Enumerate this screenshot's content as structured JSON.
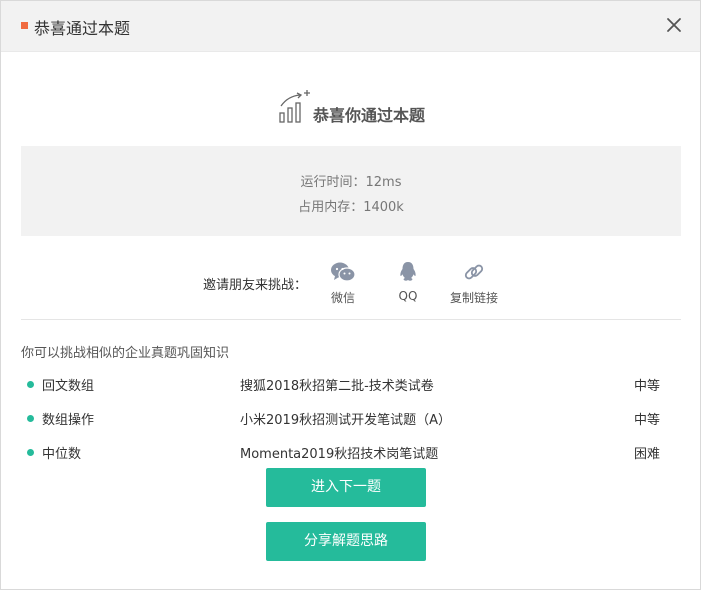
{
  "dialog": {
    "title": "恭喜通过本题",
    "accent_color": "#f06a3f"
  },
  "hero": {
    "text": "恭喜你通过本题",
    "icon": "growth-chart-icon"
  },
  "stats": {
    "runtime": "运行时间：12ms",
    "memory": "占用内存：1400k"
  },
  "share": {
    "label": "邀请朋友来挑战：",
    "items": [
      {
        "label": "微信",
        "icon": "wechat-icon"
      },
      {
        "label": "QQ",
        "icon": "qq-icon"
      },
      {
        "label": "复制链接",
        "icon": "link-icon"
      }
    ]
  },
  "recommend": {
    "hint": "你可以挑战相似的企业真题巩固知识",
    "rows": [
      {
        "tag": "回文数组",
        "paper": "搜狐2018秋招第二批-技术类试卷",
        "level": "中等"
      },
      {
        "tag": "数组操作",
        "paper": "小米2019秋招测试开发笔试题（A）",
        "level": "中等"
      },
      {
        "tag": "中位数",
        "paper": "Momenta2019秋招技术岗笔试题",
        "level": "困难"
      }
    ],
    "bullet_color": "#25bb9b"
  },
  "buttons": {
    "next": "进入下一题",
    "share_solution": "分享解题思路",
    "color": "#25bb9b"
  }
}
